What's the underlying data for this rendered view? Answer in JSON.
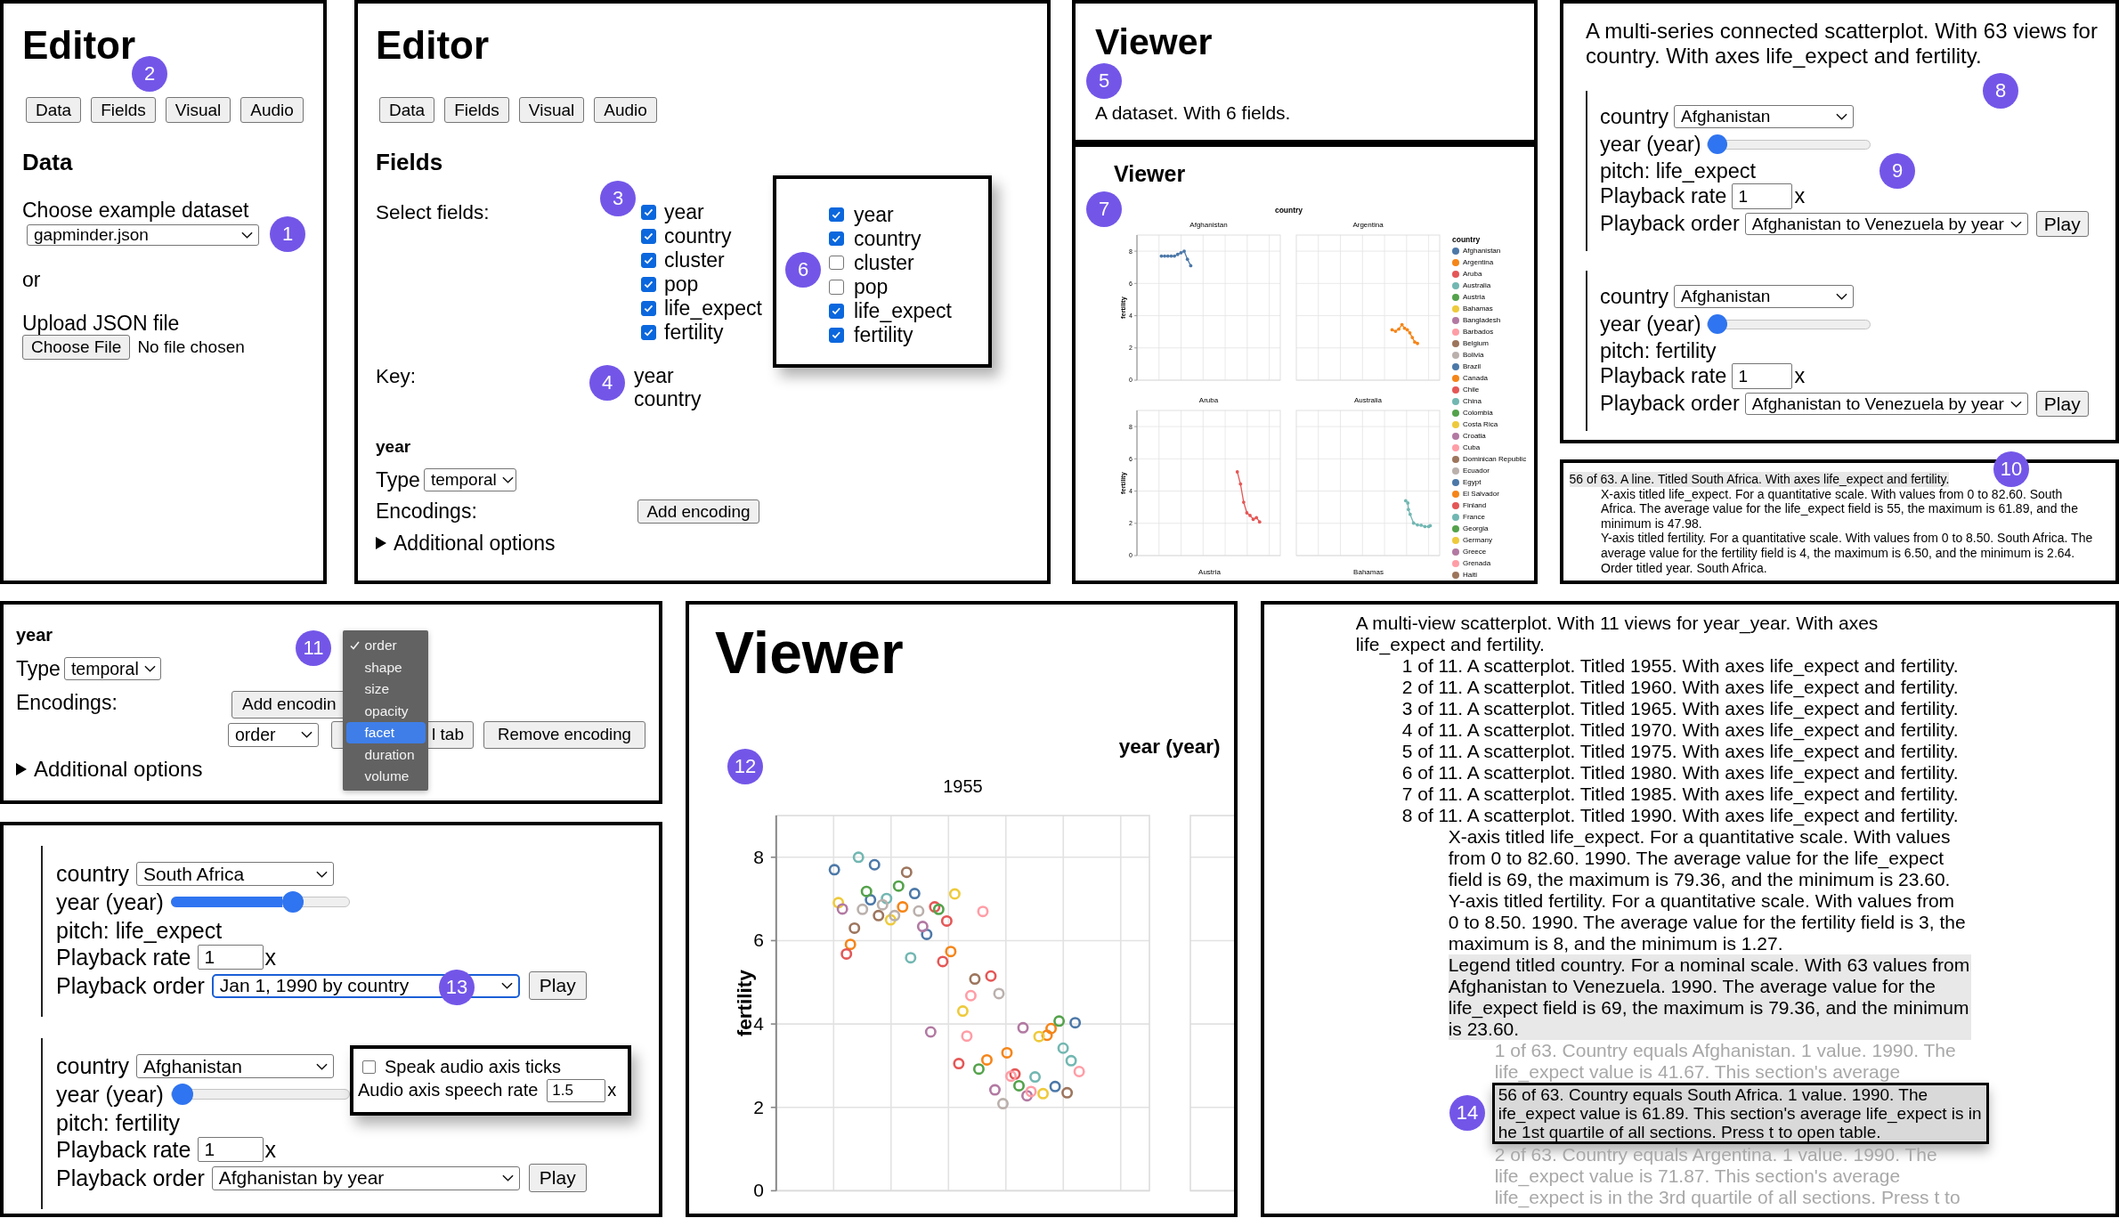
{
  "editor_data_panel": {
    "title": "Editor",
    "title_callout": "2",
    "tabs": [
      "Data",
      "Fields",
      "Visual",
      "Audio"
    ],
    "section_title": "Data",
    "dataset_label": "Choose example dataset",
    "dataset_value": "gapminder.json",
    "dataset_callout": "1",
    "or_label": "or",
    "upload_label": "Upload JSON file",
    "file_button": "Choose File",
    "file_status": "No file chosen"
  },
  "editor_fields_panel": {
    "title": "Editor",
    "tabs": [
      "Data",
      "Fields",
      "Visual",
      "Audio"
    ],
    "section_title": "Fields",
    "select_label": "Select fields:",
    "fields_callout": "3",
    "fields": [
      {
        "label": "year",
        "checked": true
      },
      {
        "label": "country",
        "checked": true
      },
      {
        "label": "cluster",
        "checked": true
      },
      {
        "label": "pop",
        "checked": true
      },
      {
        "label": "life_expect",
        "checked": true
      },
      {
        "label": "fertility",
        "checked": true
      }
    ],
    "popup_callout": "6",
    "popup_fields": [
      {
        "label": "year",
        "checked": true
      },
      {
        "label": "country",
        "checked": true
      },
      {
        "label": "cluster",
        "checked": false
      },
      {
        "label": "pop",
        "checked": false
      },
      {
        "label": "life_expect",
        "checked": true
      },
      {
        "label": "fertility",
        "checked": true
      }
    ],
    "key_label": "Key:",
    "key_callout": "4",
    "key_fields": [
      "year",
      "country"
    ],
    "field_name": "year",
    "type_label": "Type",
    "type_value": "temporal",
    "encodings_label": "Encodings:",
    "add_button": "Add encoding",
    "additional_options": {
      "label": "Additional options",
      "expanded": false
    }
  },
  "viewer_summary_panel": {
    "title": "Viewer",
    "callout": "5",
    "description": "A dataset. With 6 fields."
  },
  "viewer_chart_panel": {
    "title": "Viewer",
    "callout": "7",
    "column_title": "country",
    "facets": [
      {
        "kind": "chart",
        "label": "Afghanistan",
        "chart_data": {
          "type": "line",
          "grid": true,
          "ylabel": "fertility",
          "ylim": [
            0,
            9
          ],
          "yticks": [
            0,
            2,
            4,
            6,
            8
          ],
          "categories": [
            null,
            null,
            null,
            null,
            null,
            null,
            null,
            null,
            null,
            null,
            null,
            null,
            null,
            null,
            null,
            null,
            null,
            null,
            null,
            null,
            null,
            null,
            null,
            null,
            null,
            null,
            null,
            null,
            null,
            null,
            null,
            null,
            null,
            null,
            null,
            null,
            null,
            null,
            null,
            null,
            null,
            null,
            null,
            null
          ],
          "series": [
            {
              "color": "#4c78a8",
              "values": [
                null,
                null,
                null,
                null,
                null,
                null,
                null,
                7.7,
                7.7,
                7.7,
                7.7,
                7.7,
                7.8,
                7.9,
                8.0,
                7.5,
                7.1,
                null,
                null,
                null,
                null,
                null,
                null,
                null,
                null,
                null,
                null,
                null,
                null,
                null,
                null,
                null,
                null,
                null,
                null,
                null,
                null,
                null,
                null,
                null,
                null,
                null,
                null,
                null
              ]
            }
          ]
        }
      },
      {
        "kind": "picture",
        "label": "Argentina",
        "color": "#f58518"
      },
      {
        "kind": "chart",
        "label": "Aruba",
        "chart_data": {
          "type": "line",
          "grid": true,
          "ylabel": "fertility",
          "ylim": [
            0,
            9
          ],
          "yticks": [
            0,
            2,
            4,
            6,
            8
          ],
          "categories": [
            null,
            null,
            null,
            null,
            null,
            null,
            null,
            null,
            null,
            null,
            null,
            null,
            null,
            null,
            null,
            null,
            null,
            null,
            null,
            null,
            null,
            null,
            null,
            null,
            null,
            null,
            null,
            null,
            null,
            null,
            null,
            null,
            null,
            null,
            null,
            null,
            null,
            null,
            null,
            null,
            null,
            null,
            null,
            null,
            null
          ],
          "series": [
            {
              "color": "#e45756",
              "values": [
                null,
                null,
                null,
                null,
                null,
                null,
                null,
                null,
                null,
                null,
                null,
                null,
                null,
                null,
                null,
                null,
                null,
                null,
                null,
                null,
                null,
                null,
                null,
                null,
                null,
                null,
                null,
                null,
                null,
                null,
                null,
                5.19,
                4.44,
                3.31,
                2.65,
                2.49,
                2.25,
                2.35,
                2.09,
                null,
                null,
                null,
                null,
                null,
                null
              ]
            }
          ]
        }
      },
      {
        "kind": "picture",
        "label": "Australia",
        "color": "#72b7b2"
      }
    ],
    "next_row_labels": [
      "Austria",
      "Bahamas"
    ],
    "legend": {
      "title": "country",
      "items": [
        {
          "label": "Afghanistan",
          "color": "#4c78a8"
        },
        {
          "label": "Argentina",
          "color": "#f58518"
        },
        {
          "label": "Aruba",
          "color": "#e45756"
        },
        {
          "label": "Australia",
          "color": "#72b7b2"
        },
        {
          "label": "Austria",
          "color": "#54a24b"
        },
        {
          "label": "Bahamas",
          "color": "#eeca3b"
        },
        {
          "label": "Bangladesh",
          "color": "#b279a2"
        },
        {
          "label": "Barbados",
          "color": "#ff9da6"
        },
        {
          "label": "Belgium",
          "color": "#9d755d"
        },
        {
          "label": "Bolivia",
          "color": "#bab0ac"
        },
        {
          "label": "Brazil",
          "color": "#4c78a8"
        },
        {
          "label": "Canada",
          "color": "#f58518"
        },
        {
          "label": "Chile",
          "color": "#e45756"
        },
        {
          "label": "China",
          "color": "#72b7b2"
        },
        {
          "label": "Colombia",
          "color": "#54a24b"
        },
        {
          "label": "Costa Rica",
          "color": "#eeca3b"
        },
        {
          "label": "Croatia",
          "color": "#b279a2"
        },
        {
          "label": "Cuba",
          "color": "#ff9da6"
        },
        {
          "label": "Dominican Republic",
          "color": "#9d755d"
        },
        {
          "label": "Ecuador",
          "color": "#bab0ac"
        },
        {
          "label": "Egypt",
          "color": "#4c78a8"
        },
        {
          "label": "El Salvador",
          "color": "#f58518"
        },
        {
          "label": "Finland",
          "color": "#e45756"
        },
        {
          "label": "France",
          "color": "#72b7b2"
        },
        {
          "label": "Georgia",
          "color": "#54a24b"
        },
        {
          "label": "Germany",
          "color": "#eeca3b"
        },
        {
          "label": "Greece",
          "color": "#b279a2"
        },
        {
          "label": "Grenada",
          "color": "#ff9da6"
        },
        {
          "label": "Haiti",
          "color": "#9d755d"
        }
      ]
    }
  },
  "audio_panel": {
    "description": "A multi-series connected scatterplot. With 63 views for country. With axes life_expect and fertility.",
    "description_callout": "8",
    "controls_callout": "9",
    "groups": [
      {
        "filter_label": "country",
        "filter_value": "Afghanistan",
        "slider_label": "year (year)",
        "level": 0,
        "pitch_label": "pitch: life_expect",
        "rate_label": "Playback rate",
        "rate_value": "1",
        "rate_unit": "x",
        "order_label": "Playback order",
        "order_value": "Afghanistan to Venezuela by year",
        "play_button": "Play"
      },
      {
        "filter_label": "country",
        "filter_value": "Afghanistan",
        "slider_label": "year (year)",
        "level": 0,
        "pitch_label": "pitch: fertility",
        "rate_label": "Playback rate",
        "rate_value": "1",
        "rate_unit": "x",
        "order_label": "Playback order",
        "order_value": "Afghanistan to Venezuela by year",
        "play_button": "Play"
      }
    ]
  },
  "text_description_panel": {
    "callout": "10",
    "tree": [
      {
        "text": "56 of 63. A line. Titled South Africa. With axes life_expect and fertility.",
        "highlighted": true,
        "children": [
          {
            "text": "X-axis titled life_expect. For a quantitative scale. With values from 0 to 82.60. South Africa. The average value for the life_expect field is 55, the maximum is 61.89, and the minimum is 47.98.",
            "highlighted": false
          },
          {
            "text": "Y-axis titled fertility. For a quantitative scale. With values from 0 to 8.50. South Africa. The average value for the fertility field is 4, the maximum is 6.50, and the minimum is 2.64.",
            "highlighted": false
          },
          {
            "text": "Order titled year. South Africa.",
            "highlighted": false
          }
        ]
      }
    ]
  },
  "encoding_panel": {
    "field_name": "year",
    "callout": "11",
    "type_label": "Type",
    "type_value": "temporal",
    "encodings_label": "Encodings:",
    "add_button": "Add encodin",
    "encoding_value": "order",
    "covered_button": "l tab",
    "remove_button": "Remove encoding",
    "additional_options": {
      "label": "Additional options",
      "expanded": false
    },
    "menu": [
      {
        "label": "order",
        "checked": true,
        "highlighted": false
      },
      {
        "label": "shape",
        "checked": false,
        "highlighted": false
      },
      {
        "label": "size",
        "checked": false,
        "highlighted": false
      },
      {
        "label": "opacity",
        "checked": false,
        "highlighted": false
      },
      {
        "label": "facet",
        "checked": false,
        "highlighted": true
      },
      {
        "label": "duration",
        "checked": false,
        "highlighted": false
      },
      {
        "label": "volume",
        "checked": false,
        "highlighted": false
      }
    ]
  },
  "playback_panel": {
    "callout": "13",
    "groups": [
      {
        "filter_label": "country",
        "filter_value": "South Africa",
        "slider_label": "year (year)",
        "level": 0.71,
        "pitch_label": "pitch: life_expect",
        "rate_label": "Playback rate",
        "rate_value": "1",
        "rate_unit": "x",
        "order_label": "Playback order",
        "order_value": "Jan 1, 1990 by country",
        "order_focused": true,
        "play_button": "Play"
      },
      {
        "filter_label": "country",
        "filter_value": "Afghanistan",
        "slider_label": "year (year)",
        "level": 0,
        "pitch_label": "pitch: fertility",
        "rate_label": "Playback rate",
        "rate_value": "1",
        "rate_unit": "x",
        "order_label": "Playback order",
        "order_value": "Afghanistan by year",
        "order_focused": false,
        "play_button": "Play"
      }
    ],
    "settings_popup": {
      "ticks_label": "Speak audio axis ticks",
      "ticks_checked": false,
      "rate_label": "Audio axis speech rate",
      "rate_value": "1.5",
      "rate_unit": "x"
    }
  },
  "viewer_scatter_panel": {
    "title": "Viewer",
    "callout": "12",
    "facet_header": "year (year)",
    "chart_data": {
      "type": "scatter",
      "grid": true,
      "title": "1955",
      "ylabel": "fertility",
      "ylim": [
        0,
        9
      ],
      "yticks": [
        0,
        2,
        4,
        6,
        8
      ],
      "categories": [
        null,
        null,
        null,
        null,
        null,
        null,
        null,
        null,
        null,
        null,
        null,
        null,
        null,
        null,
        null,
        null,
        null,
        null,
        null,
        null,
        null,
        null,
        null,
        null,
        null,
        null,
        null,
        null,
        null,
        null,
        null,
        null,
        null,
        null,
        null,
        null,
        null,
        null,
        null,
        null,
        null,
        null,
        null,
        null,
        null,
        null,
        null,
        null,
        null,
        null,
        null,
        null,
        null,
        null,
        null,
        null,
        null,
        null,
        null,
        null,
        null,
        null,
        null,
        null,
        null,
        null,
        null,
        null,
        null,
        null,
        null,
        null,
        null,
        null,
        null,
        null,
        null,
        null,
        null,
        null,
        null,
        null,
        null,
        null,
        null,
        null,
        null,
        null,
        null,
        null,
        null,
        null,
        null
      ],
      "series": [
        {
          "color": "#4c78a8",
          "values": [
            null,
            null,
            null,
            null,
            null,
            null,
            null,
            null,
            null,
            null,
            null,
            null,
            null,
            null,
            7.7,
            null,
            null,
            null,
            null,
            null,
            null,
            null,
            null,
            6.98,
            7.82,
            null,
            null,
            null,
            null,
            null,
            null,
            null,
            null,
            null,
            7.13,
            null,
            null,
            6.15,
            null,
            null,
            null,
            null,
            null,
            null,
            null,
            null,
            null,
            null,
            null,
            null,
            null,
            null,
            null,
            null,
            null,
            null,
            null,
            null,
            null,
            null,
            null,
            null,
            null,
            null,
            null,
            null,
            null,
            null,
            null,
            2.5,
            null,
            null,
            null,
            null,
            4.03,
            null,
            null,
            null,
            null,
            null,
            null,
            null,
            null,
            null,
            null,
            null,
            null,
            null,
            null,
            null,
            null,
            null,
            null
          ]
        },
        {
          "color": "#f58518",
          "values": [
            null,
            null,
            null,
            null,
            null,
            null,
            null,
            null,
            null,
            null,
            null,
            null,
            null,
            null,
            null,
            null,
            null,
            null,
            5.91,
            null,
            null,
            null,
            null,
            null,
            null,
            null,
            null,
            null,
            null,
            null,
            null,
            6.81,
            null,
            null,
            null,
            null,
            null,
            null,
            null,
            null,
            null,
            null,
            null,
            5.74,
            null,
            null,
            null,
            null,
            null,
            null,
            null,
            null,
            3.14,
            null,
            null,
            null,
            null,
            3.31,
            null,
            null,
            null,
            null,
            null,
            null,
            null,
            null,
            null,
            3.73,
            3.89,
            null,
            null,
            null,
            null,
            null,
            null,
            null,
            null,
            null,
            null,
            null,
            null,
            null,
            null,
            null,
            null,
            null,
            null,
            null,
            null,
            null,
            null,
            null,
            null
          ]
        },
        {
          "color": "#e45756",
          "values": [
            null,
            null,
            null,
            null,
            null,
            null,
            null,
            null,
            null,
            null,
            null,
            null,
            null,
            null,
            null,
            null,
            null,
            5.68,
            null,
            null,
            null,
            null,
            null,
            null,
            null,
            null,
            null,
            null,
            null,
            null,
            null,
            null,
            null,
            null,
            null,
            null,
            null,
            null,
            null,
            6.81,
            null,
            5.5,
            6.47,
            null,
            null,
            3.05,
            null,
            null,
            null,
            null,
            null,
            null,
            null,
            5.15,
            null,
            null,
            null,
            null,
            null,
            2.8,
            null,
            null,
            null,
            null,
            null,
            null,
            null,
            null,
            null,
            null,
            null,
            null,
            null,
            null,
            null,
            null,
            null,
            null,
            null,
            null,
            null,
            null,
            null,
            null,
            null,
            null,
            null,
            null,
            null,
            null,
            null,
            null,
            null
          ]
        },
        {
          "color": "#72b7b2",
          "values": [
            null,
            null,
            null,
            null,
            null,
            null,
            null,
            null,
            null,
            null,
            null,
            null,
            null,
            null,
            null,
            null,
            null,
            null,
            null,
            null,
            8.0,
            null,
            null,
            null,
            null,
            null,
            null,
            7.01,
            null,
            null,
            null,
            null,
            null,
            5.59,
            null,
            null,
            null,
            null,
            null,
            null,
            null,
            null,
            null,
            null,
            null,
            null,
            null,
            null,
            null,
            null,
            null,
            null,
            null,
            null,
            null,
            null,
            null,
            null,
            null,
            null,
            null,
            null,
            null,
            null,
            2.73,
            null,
            null,
            null,
            null,
            null,
            null,
            3.42,
            null,
            3.12,
            null,
            null,
            null,
            null,
            null,
            null,
            null,
            null,
            null,
            null,
            null,
            null,
            null,
            null,
            null,
            null,
            null,
            null,
            null
          ]
        },
        {
          "color": "#54a24b",
          "values": [
            null,
            null,
            null,
            null,
            null,
            null,
            null,
            null,
            null,
            null,
            null,
            null,
            null,
            null,
            null,
            null,
            null,
            null,
            null,
            null,
            null,
            null,
            7.18,
            null,
            null,
            null,
            null,
            null,
            null,
            null,
            7.31,
            null,
            null,
            null,
            null,
            null,
            null,
            null,
            null,
            null,
            6.75,
            null,
            null,
            null,
            null,
            null,
            null,
            null,
            null,
            null,
            2.92,
            null,
            null,
            null,
            null,
            null,
            null,
            null,
            null,
            null,
            2.52,
            null,
            null,
            null,
            null,
            null,
            null,
            null,
            null,
            null,
            4.07,
            null,
            null,
            null,
            null,
            null,
            null,
            null,
            null,
            null,
            null,
            null,
            null,
            null,
            null,
            null,
            null,
            null,
            null,
            null,
            null,
            null,
            null
          ]
        },
        {
          "color": "#eeca3b",
          "values": [
            null,
            null,
            null,
            null,
            null,
            null,
            null,
            null,
            null,
            null,
            null,
            null,
            null,
            null,
            null,
            6.91,
            null,
            null,
            null,
            null,
            null,
            null,
            null,
            null,
            null,
            null,
            null,
            null,
            6.5,
            null,
            null,
            null,
            null,
            null,
            null,
            null,
            null,
            null,
            null,
            null,
            null,
            null,
            null,
            null,
            7.12,
            null,
            4.31,
            null,
            null,
            null,
            null,
            null,
            null,
            null,
            null,
            null,
            null,
            null,
            null,
            null,
            null,
            null,
            null,
            null,
            null,
            3.7,
            2.33,
            null,
            null,
            null,
            null,
            null,
            null,
            null,
            null,
            null,
            null,
            null,
            null,
            null,
            null,
            null,
            null,
            null,
            null,
            null,
            null,
            null,
            null,
            null,
            null,
            null,
            null
          ]
        },
        {
          "color": "#b279a2",
          "values": [
            null,
            null,
            null,
            null,
            null,
            null,
            null,
            null,
            null,
            null,
            null,
            null,
            null,
            null,
            null,
            null,
            6.76,
            null,
            null,
            null,
            null,
            null,
            null,
            null,
            null,
            null,
            null,
            null,
            null,
            null,
            null,
            null,
            null,
            null,
            null,
            null,
            6.34,
            null,
            3.81,
            null,
            null,
            null,
            null,
            null,
            null,
            null,
            null,
            null,
            null,
            null,
            null,
            null,
            null,
            null,
            2.42,
            null,
            null,
            null,
            null,
            null,
            null,
            3.91,
            2.28,
            null,
            null,
            null,
            null,
            null,
            null,
            null,
            null,
            null,
            null,
            null,
            null,
            null,
            null,
            null,
            null,
            null,
            null,
            null,
            null,
            null,
            null,
            null,
            null,
            null,
            null,
            null,
            null,
            null,
            null
          ]
        },
        {
          "color": "#ff9da6",
          "values": [
            null,
            null,
            null,
            null,
            null,
            null,
            null,
            null,
            null,
            null,
            null,
            null,
            null,
            null,
            null,
            null,
            null,
            null,
            null,
            null,
            null,
            null,
            null,
            null,
            null,
            null,
            null,
            null,
            null,
            null,
            null,
            null,
            null,
            null,
            null,
            null,
            null,
            null,
            null,
            null,
            null,
            null,
            null,
            null,
            null,
            null,
            null,
            3.71,
            4.68,
            null,
            null,
            6.7,
            null,
            null,
            null,
            null,
            null,
            null,
            2.75,
            null,
            null,
            null,
            null,
            2.38,
            null,
            null,
            null,
            null,
            null,
            null,
            null,
            null,
            null,
            null,
            null,
            2.86,
            null,
            null,
            null,
            null,
            null,
            null,
            null,
            null,
            null,
            null,
            null,
            null,
            null,
            null,
            null,
            null,
            null
          ]
        },
        {
          "color": "#9d755d",
          "values": [
            null,
            null,
            null,
            null,
            null,
            null,
            null,
            null,
            null,
            null,
            null,
            null,
            null,
            null,
            null,
            null,
            null,
            null,
            null,
            6.3,
            null,
            null,
            null,
            null,
            null,
            6.6,
            null,
            null,
            null,
            null,
            null,
            null,
            7.64,
            null,
            null,
            null,
            null,
            null,
            null,
            null,
            null,
            null,
            null,
            null,
            null,
            null,
            null,
            null,
            null,
            5.08,
            null,
            null,
            null,
            null,
            null,
            null,
            null,
            null,
            null,
            null,
            null,
            null,
            null,
            null,
            null,
            null,
            null,
            null,
            null,
            null,
            null,
            null,
            2.35,
            null,
            null,
            null,
            null,
            null,
            null,
            null,
            null,
            null,
            null,
            null,
            null,
            null,
            null,
            null,
            null,
            null,
            null,
            null,
            null
          ]
        },
        {
          "color": "#bab0ac",
          "values": [
            null,
            null,
            null,
            null,
            null,
            null,
            null,
            null,
            null,
            null,
            null,
            null,
            null,
            null,
            null,
            null,
            null,
            null,
            null,
            null,
            null,
            6.75,
            null,
            null,
            null,
            null,
            6.86,
            null,
            null,
            6.6,
            null,
            null,
            null,
            null,
            null,
            6.71,
            null,
            null,
            null,
            null,
            null,
            null,
            null,
            null,
            null,
            null,
            null,
            null,
            null,
            null,
            null,
            null,
            null,
            null,
            null,
            4.73,
            2.09,
            null,
            null,
            null,
            null,
            null,
            null,
            null,
            null,
            null,
            null,
            null,
            null,
            null,
            null,
            null,
            null,
            null,
            null,
            null,
            null,
            null,
            null,
            null,
            null,
            null,
            null,
            null,
            null,
            null,
            null,
            null,
            null,
            null,
            null,
            null,
            null
          ]
        }
      ]
    }
  },
  "description_tree_panel": {
    "callout": "14",
    "tree": [
      {
        "text": "A multi-view scatterplot. With 11 views for year_year. With axes life_expect and fertility.",
        "highlighted": false,
        "children": [
          {
            "text": "1 of 11. A scatterplot. Titled 1955. With axes life_expect and fertility.",
            "highlighted": false
          },
          {
            "text": "2 of 11. A scatterplot. Titled 1960. With axes life_expect and fertility.",
            "highlighted": false
          },
          {
            "text": "3 of 11. A scatterplot. Titled 1965. With axes life_expect and fertility.",
            "highlighted": false
          },
          {
            "text": "4 of 11. A scatterplot. Titled 1970. With axes life_expect and fertility.",
            "highlighted": false
          },
          {
            "text": "5 of 11. A scatterplot. Titled 1975. With axes life_expect and fertility.",
            "highlighted": false
          },
          {
            "text": "6 of 11. A scatterplot. Titled 1980. With axes life_expect and fertility.",
            "highlighted": false
          },
          {
            "text": "7 of 11. A scatterplot. Titled 1985. With axes life_expect and fertility.",
            "highlighted": false
          },
          {
            "text": "8 of 11. A scatterplot. Titled 1990. With axes life_expect and fertility.",
            "highlighted": false,
            "children": [
              {
                "text": "X-axis titled life_expect. For a quantitative scale. With values from 0 to 82.60. 1990. The average value for the life_expect field is 69, the maximum is 79.36, and the minimum is 23.60.",
                "highlighted": false
              },
              {
                "text": "Y-axis titled fertility. For a quantitative scale. With values from 0 to 8.50. 1990. The average value for the fertility field is 3, the maximum is 8, and the minimum is 1.27.",
                "highlighted": false
              },
              {
                "text": "Legend titled country. For a nominal scale. With 63 values from Afghanistan to Venezuela. 1990. The average value for the life_expect field is 69, the maximum is 79.36, and the minimum is 23.60.",
                "highlighted": true,
                "children": [
                  {
                    "kind": "faded",
                    "text": "1 of 63. Country equals Afghanistan. 1 value. 1990. The life_expect value is 41.67. This section's average"
                  },
                  {
                    "kind": "tooltip",
                    "lines": [
                      "56 of 63. Country equals South Africa. 1 value. 1990. The",
                      "ife_expect value is 61.89. This section's average life_expect is in",
                      "he 1st quartile of all sections. Press t to open table."
                    ]
                  },
                  {
                    "kind": "faded",
                    "text": "2 of 63. Country equals Argentina. 1 value. 1990. The life_expect value is 71.87. This section's average life_expect is in the 3rd quartile of all sections. Press t to"
                  }
                ]
              }
            ]
          }
        ]
      }
    ]
  }
}
